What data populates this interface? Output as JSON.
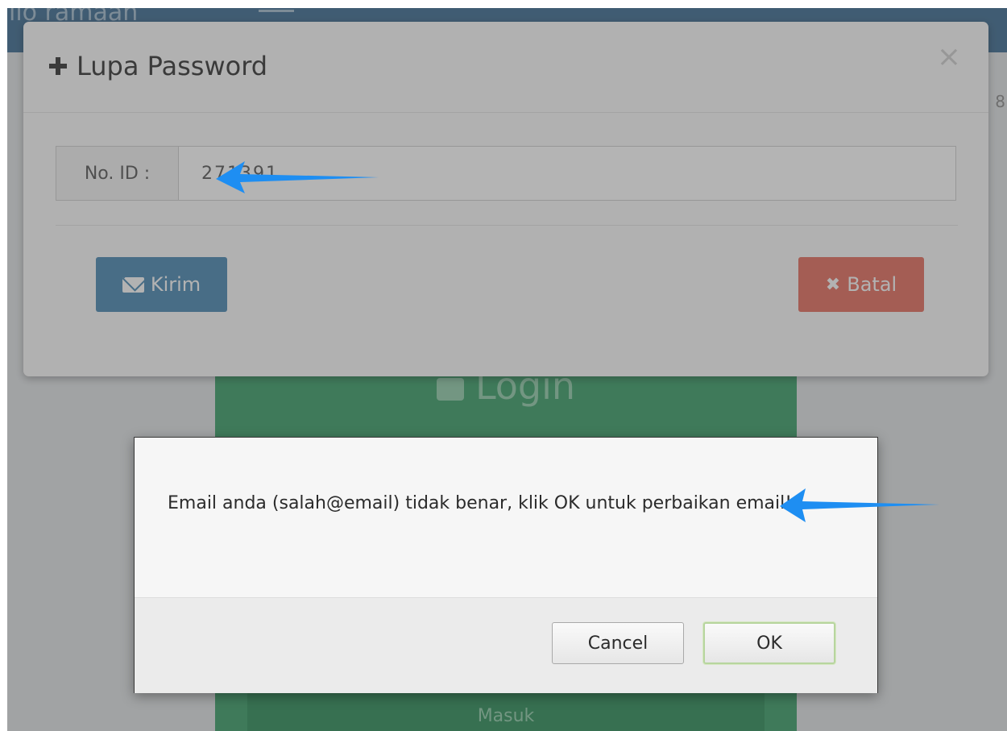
{
  "background": {
    "brand_text": "ilo ramaan",
    "right_peek_text": "8",
    "login_title": "Login",
    "masuk_label": "Masuk"
  },
  "lupa_modal": {
    "title": "Lupa Password",
    "close_glyph": "×",
    "id_label": "No. ID :",
    "id_value": "271391",
    "kirim_label": "Kirim",
    "batal_label": "Batal",
    "batal_glyph": "✖"
  },
  "alert": {
    "message": "Email anda (salah@email) tidak benar, klik OK untuk perbaikan email!",
    "cancel_label": "Cancel",
    "ok_label": "OK"
  },
  "colors": {
    "topbar": "#3d6a8e",
    "login_panel": "#3a9a66",
    "kirim": "#4a85ad",
    "batal": "#dd6b5c",
    "arrow": "#1e8ef2"
  },
  "icons": [
    "plus-icon",
    "close-icon",
    "envelope-icon",
    "x-icon",
    "lock-icon",
    "arrow-annotation-icon"
  ]
}
